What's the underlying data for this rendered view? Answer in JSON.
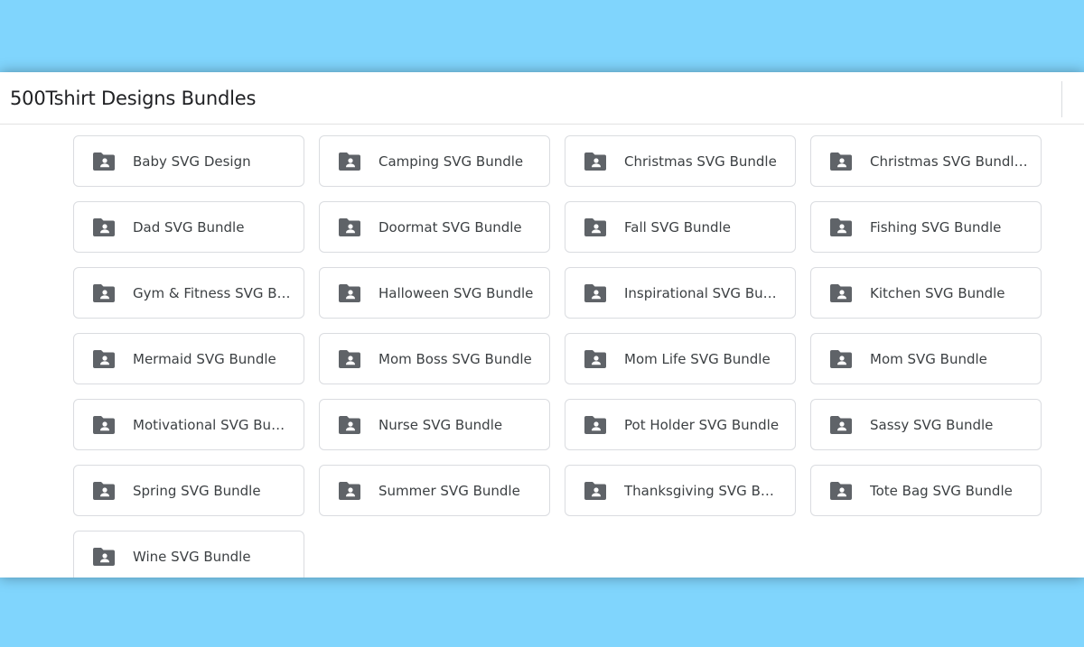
{
  "header": {
    "title": "500Tshirt Designs Bundles"
  },
  "colors": {
    "backdrop": "#80d5fd",
    "folder_icon": "#5f6368",
    "label_text": "#3c4043",
    "card_border": "#dadce0"
  },
  "folders": [
    {
      "label": "Baby SVG Design",
      "icon": "shared-folder-icon"
    },
    {
      "label": "Camping SVG Bundle",
      "icon": "shared-folder-icon"
    },
    {
      "label": "Christmas SVG Bundle",
      "icon": "shared-folder-icon"
    },
    {
      "label": "Christmas SVG Bundle V...",
      "icon": "shared-folder-icon"
    },
    {
      "label": "Dad SVG Bundle",
      "icon": "shared-folder-icon"
    },
    {
      "label": "Doormat SVG Bundle",
      "icon": "shared-folder-icon"
    },
    {
      "label": "Fall SVG Bundle",
      "icon": "shared-folder-icon"
    },
    {
      "label": "Fishing SVG Bundle",
      "icon": "shared-folder-icon"
    },
    {
      "label": "Gym & Fitness SVG Bun...",
      "icon": "shared-folder-icon"
    },
    {
      "label": "Halloween SVG Bundle",
      "icon": "shared-folder-icon"
    },
    {
      "label": "Inspirational SVG Bundle...",
      "icon": "shared-folder-icon"
    },
    {
      "label": "Kitchen SVG Bundle",
      "icon": "shared-folder-icon"
    },
    {
      "label": "Mermaid SVG Bundle",
      "icon": "shared-folder-icon"
    },
    {
      "label": "Mom Boss SVG Bundle",
      "icon": "shared-folder-icon"
    },
    {
      "label": "Mom Life SVG Bundle",
      "icon": "shared-folder-icon"
    },
    {
      "label": "Mom SVG Bundle",
      "icon": "shared-folder-icon"
    },
    {
      "label": "Motivational SVG Bundle",
      "icon": "shared-folder-icon"
    },
    {
      "label": "Nurse SVG Bundle",
      "icon": "shared-folder-icon"
    },
    {
      "label": "Pot Holder SVG Bundle",
      "icon": "shared-folder-icon"
    },
    {
      "label": "Sassy SVG Bundle",
      "icon": "shared-folder-icon"
    },
    {
      "label": "Spring SVG Bundle",
      "icon": "shared-folder-icon"
    },
    {
      "label": "Summer SVG Bundle",
      "icon": "shared-folder-icon"
    },
    {
      "label": "Thanksgiving SVG Bundle",
      "icon": "shared-folder-icon"
    },
    {
      "label": "Tote Bag SVG Bundle",
      "icon": "shared-folder-icon"
    },
    {
      "label": "Wine SVG Bundle",
      "icon": "shared-folder-icon"
    }
  ]
}
